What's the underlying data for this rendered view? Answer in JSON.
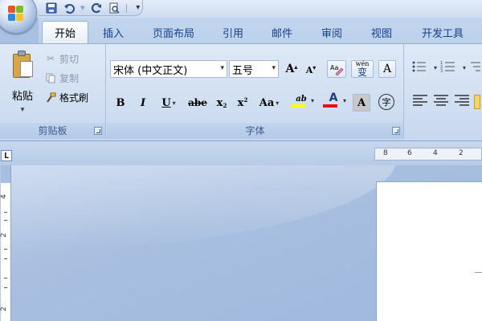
{
  "qat": {
    "items": [
      "save-icon",
      "undo-icon",
      "redo-icon",
      "print-preview-icon"
    ],
    "customize_label": "▾"
  },
  "tabs": [
    {
      "label": "开始",
      "active": true
    },
    {
      "label": "插入",
      "active": false
    },
    {
      "label": "页面布局",
      "active": false
    },
    {
      "label": "引用",
      "active": false
    },
    {
      "label": "邮件",
      "active": false
    },
    {
      "label": "审阅",
      "active": false
    },
    {
      "label": "视图",
      "active": false
    },
    {
      "label": "开发工具",
      "active": false
    }
  ],
  "clipboard": {
    "paste_label": "粘贴",
    "cut_label": "剪切",
    "copy_label": "复制",
    "format_painter_label": "格式刷",
    "group_label": "剪贴板"
  },
  "font": {
    "font_name": "宋体 (中文正文)",
    "font_size": "五号",
    "grow_label": "A",
    "shrink_label": "A",
    "wen_label": "wén",
    "wen_char": "变",
    "border_char_label": "A",
    "bold_label": "B",
    "italic_label": "I",
    "underline_label": "U",
    "strike_label": "abe",
    "subscript_label": "x",
    "superscript_label": "x",
    "case_label": "Aa",
    "highlight_label": "ab",
    "color_label": "A",
    "shade_label": "A",
    "enclose_label": "字",
    "group_label": "字体"
  },
  "colors": {
    "accent": "#15428b",
    "highlight": "#ffff00",
    "font_color": "#e81010"
  },
  "ruler": {
    "horizontal_numbers": [
      "8",
      "6",
      "4",
      "2"
    ],
    "vertical_numbers": [
      "4",
      "2",
      "2"
    ],
    "corner_label": "L"
  }
}
